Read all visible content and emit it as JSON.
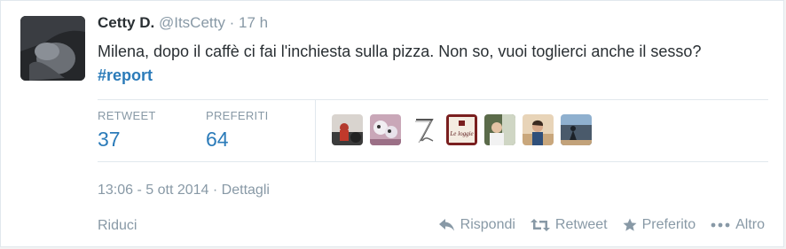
{
  "tweet": {
    "fullname": "Cetty D.",
    "username": "@ItsCetty",
    "separator": "·",
    "time": "17 h",
    "text_before": "Milena, dopo il caffè ci fai l'inchiesta sulla pizza. Non so, vuoi toglierci anche il sesso? ",
    "hashtag_symbol": "#",
    "hashtag": "report"
  },
  "stats": {
    "retweet_label": "RETWEET",
    "retweet_count": "37",
    "favorite_label": "PREFERITI",
    "favorite_count": "64"
  },
  "footer": {
    "timestamp": "13:06 - 5 ott 2014",
    "separator": "·",
    "details_label": "Dettagli",
    "collapse_label": "Riduci"
  },
  "actions": {
    "reply_label": "Rispondi",
    "retweet_label": "Retweet",
    "favorite_label": "Preferito",
    "more_label": "Altro"
  },
  "favoriters": {
    "logo_text": "Le loggie"
  },
  "colors": {
    "link": "#2b7bb9",
    "muted": "#8899a6",
    "text": "#292f33"
  }
}
